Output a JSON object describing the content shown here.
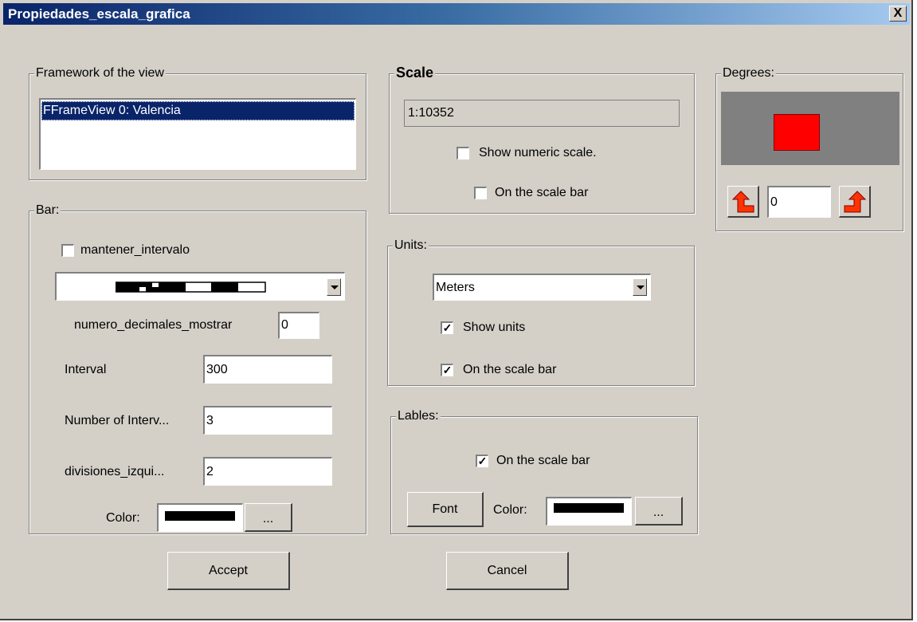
{
  "window": {
    "title": "Propiedades_escala_grafica",
    "close_label": "X"
  },
  "framework": {
    "legend": "Framework of the view",
    "items": [
      "FFrameView 0: Valencia"
    ]
  },
  "bar": {
    "legend": "Bar:",
    "mantener_intervalo_label": "mantener_intervalo",
    "mantener_intervalo_checked": false,
    "numero_decimales_label": "numero_decimales_mostrar",
    "numero_decimales_value": "0",
    "interval_label": "Interval",
    "interval_value": "300",
    "num_intervals_label": "Number of Interv...",
    "num_intervals_value": "3",
    "divisiones_label": "divisiones_izqui...",
    "divisiones_value": "2",
    "color_label": "Color:",
    "color_value": "#000000",
    "color_btn_label": "..."
  },
  "scale": {
    "legend": "Scale",
    "value": "1:10352",
    "show_numeric_label": "Show numeric scale.",
    "show_numeric_checked": false,
    "on_bar_label": "On the scale bar",
    "on_bar_checked": false
  },
  "units": {
    "legend": "Units:",
    "selected": "Meters",
    "show_units_label": "Show units",
    "show_units_checked": true,
    "on_bar_label": "On the scale bar",
    "on_bar_checked": true
  },
  "labels": {
    "legend": "Lables:",
    "on_bar_label": "On the scale bar",
    "on_bar_checked": true,
    "font_btn_label": "Font",
    "color_label": "Color:",
    "color_value": "#000000",
    "color_btn_label": "..."
  },
  "degrees": {
    "legend": "Degrees:",
    "value": "0",
    "preview_color": "#ff0000"
  },
  "buttons": {
    "accept": "Accept",
    "cancel": "Cancel"
  },
  "icons": {
    "rotate_left": "rotate-left-arrow-icon",
    "rotate_right": "rotate-right-arrow-icon",
    "dropdown": "chevron-down-icon"
  },
  "check_mark": "✓"
}
